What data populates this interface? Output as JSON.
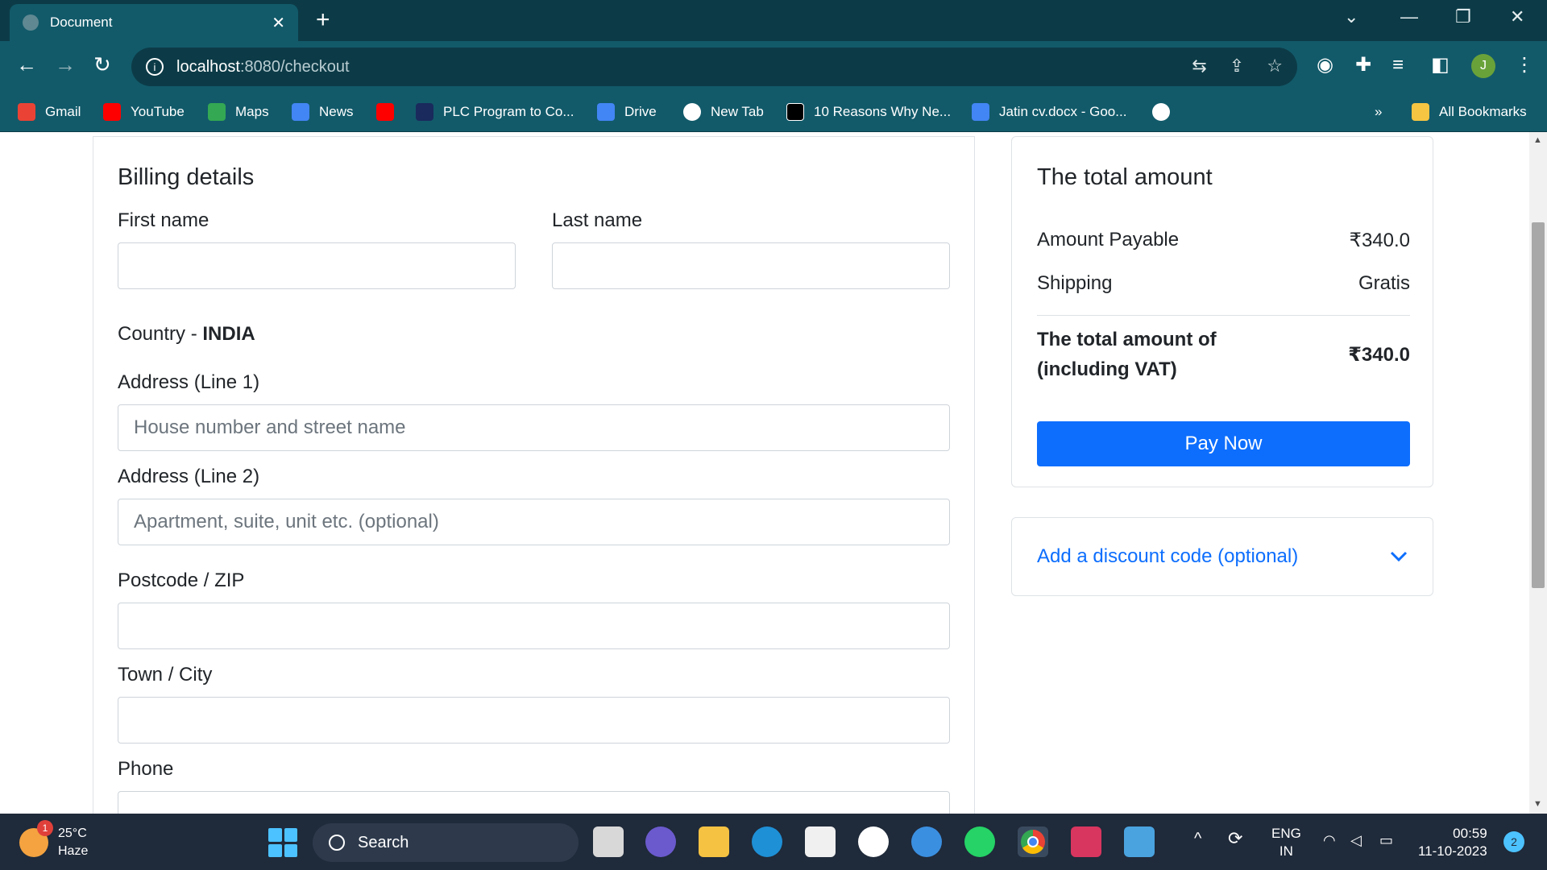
{
  "browser": {
    "tab_title": "Document",
    "tab_close": "✕",
    "new_tab": "+",
    "url_host": "localhost",
    "url_path": ":8080/checkout",
    "profile_initial": "J",
    "bookmarks": [
      {
        "label": "Gmail",
        "icon": "gmail-icon",
        "color": "#ea4335"
      },
      {
        "label": "YouTube",
        "icon": "youtube-icon",
        "color": "#ff0000"
      },
      {
        "label": "Maps",
        "icon": "maps-icon",
        "color": "#34a853"
      },
      {
        "label": "News",
        "icon": "news-icon",
        "color": "#4285f4"
      },
      {
        "label": "",
        "icon": "youtube-icon",
        "color": "#ff0000"
      },
      {
        "label": "PLC Program to Co...",
        "icon": "sf-icon",
        "color": "#1a2a5c"
      },
      {
        "label": "Drive",
        "icon": "docs-icon",
        "color": "#4285f4"
      },
      {
        "label": "New Tab",
        "icon": "globe-icon",
        "color": "#ffffff"
      },
      {
        "label": "10 Reasons Why Ne...",
        "icon": "forbes-icon",
        "color": "#000000"
      },
      {
        "label": "Jatin cv.docx - Goo...",
        "icon": "docs-icon",
        "color": "#4285f4"
      },
      {
        "label": "",
        "icon": "globe-icon",
        "color": "#ffffff"
      }
    ],
    "bookmarks_overflow": "»",
    "all_bookmarks": "All Bookmarks"
  },
  "billing": {
    "title": "Billing details",
    "first_name_label": "First name",
    "first_name_value": "",
    "last_name_label": "Last name",
    "last_name_value": "",
    "country_label": "Country - ",
    "country_value": "INDIA",
    "address1_label": "Address (Line 1)",
    "address1_placeholder": "House number and street name",
    "address2_label": "Address (Line 2)",
    "address2_placeholder": "Apartment, suite, unit etc. (optional)",
    "postcode_label": "Postcode / ZIP",
    "postcode_value": "",
    "city_label": "Town / City",
    "city_value": "",
    "phone_label": "Phone",
    "phone_value": ""
  },
  "summary": {
    "title": "The total amount",
    "amount_payable_label": "Amount Payable",
    "amount_payable_value": "₹340.0",
    "shipping_label": "Shipping",
    "shipping_value": "Gratis",
    "total_label_line1": "The total amount of",
    "total_label_line2": "(including VAT)",
    "total_value": "₹340.0",
    "pay_button": "Pay Now",
    "pay_button_color": "#0d6efd"
  },
  "discount": {
    "label": "Add a discount code (optional)"
  },
  "taskbar": {
    "weather_temp": "25°C",
    "weather_desc": "Haze",
    "weather_badge": "1",
    "search_label": "Search",
    "lang_line1": "ENG",
    "lang_line2": "IN",
    "time": "00:59",
    "date": "11-10-2023",
    "notification_count": "2"
  }
}
